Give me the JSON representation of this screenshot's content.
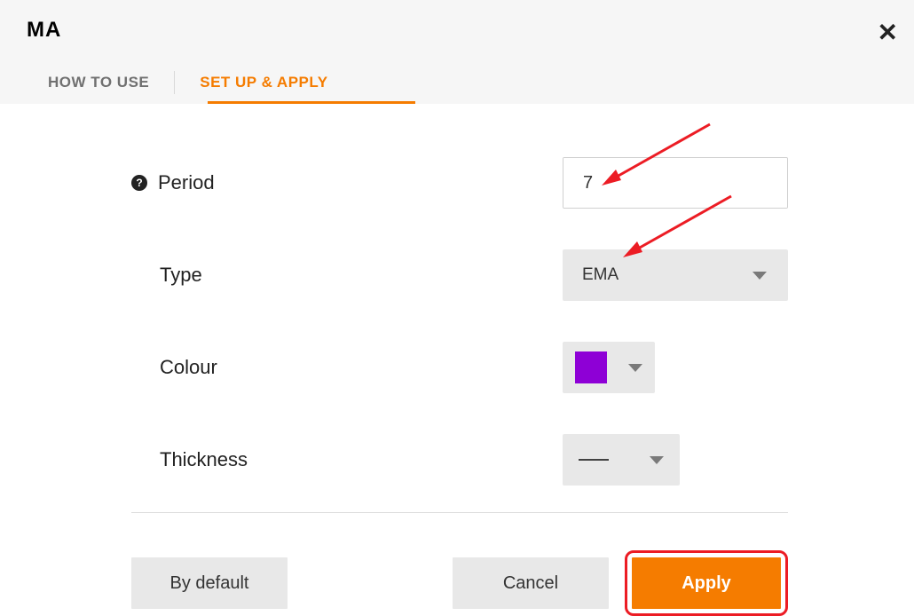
{
  "header": {
    "title": "MA"
  },
  "tabs": {
    "how_to_use": "HOW TO USE",
    "setup": "SET UP & APPLY"
  },
  "form": {
    "period_label": "Period",
    "period_value": "7",
    "type_label": "Type",
    "type_value": "EMA",
    "colour_label": "Colour",
    "colour_value": "#8e00d6",
    "thickness_label": "Thickness"
  },
  "actions": {
    "default": "By default",
    "cancel": "Cancel",
    "apply": "Apply"
  }
}
